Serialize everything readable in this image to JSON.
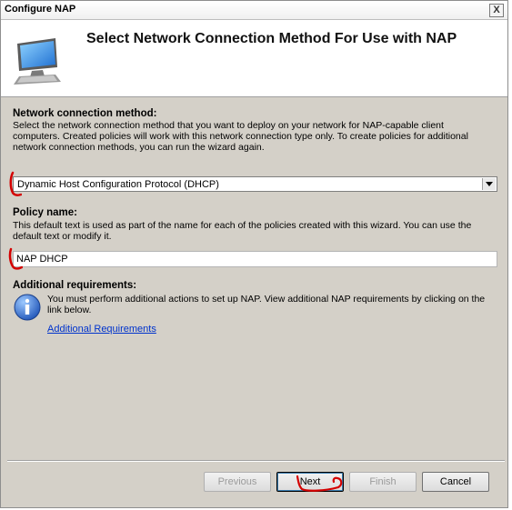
{
  "window": {
    "title": "Configure NAP",
    "close_glyph": "X"
  },
  "header": {
    "title": "Select Network Connection Method For Use with NAP",
    "icon": "monitor-icon"
  },
  "connection_method": {
    "label": "Network connection method:",
    "description": "Select the network connection method that you want to deploy on your network for NAP-capable client computers. Created policies will work with this network connection type only. To create policies for additional network connection methods, you can run the wizard again.",
    "selected": "Dynamic Host Configuration Protocol (DHCP)"
  },
  "policy": {
    "label": "Policy name:",
    "description": "This default text is used as part of the name for each of the policies created with this wizard. You can use the default text or modify it.",
    "value": "NAP DHCP"
  },
  "additional": {
    "label": "Additional requirements:",
    "icon": "info-icon",
    "text": "You must perform additional actions to set up NAP. View additional NAP requirements by clicking on the link below.",
    "link": "Additional Requirements"
  },
  "buttons": {
    "previous": "Previous",
    "next": "Next",
    "finish": "Finish",
    "cancel": "Cancel"
  },
  "colors": {
    "dialog_bg": "#d4d0c8",
    "link": "#0033cc",
    "annotation": "#d40000"
  }
}
